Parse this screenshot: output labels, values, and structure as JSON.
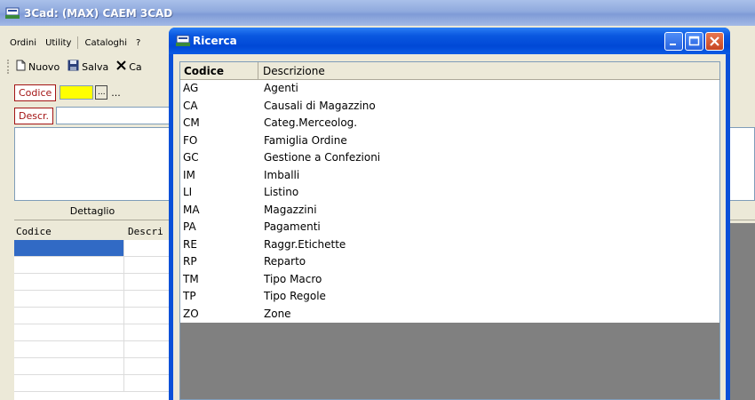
{
  "main_window": {
    "title": "3Cad: (MAX) CAEM 3CAD",
    "menu": [
      "Ordini",
      "Utility",
      "Cataloghi",
      "?"
    ],
    "toolbar": {
      "nuovo_label": "Nuovo",
      "salva_label": "Salva",
      "cancel_label": "Ca"
    },
    "codice_label": "Codice",
    "codice_browse": "...",
    "codice_dots": "...",
    "descr_label": "Descr.",
    "dettaglio_label": "Dettaglio",
    "grid": {
      "col_codice": "Codice",
      "col_descr": "Descri"
    }
  },
  "ricerca": {
    "title": "Ricerca",
    "columns": {
      "codice": "Codice",
      "descrizione": "Descrizione"
    },
    "rows": [
      {
        "codice": "AG",
        "descrizione": "Agenti"
      },
      {
        "codice": "CA",
        "descrizione": "Causali di Magazzino"
      },
      {
        "codice": "CM",
        "descrizione": "Categ.Merceolog."
      },
      {
        "codice": "FO",
        "descrizione": "Famiglia Ordine"
      },
      {
        "codice": "GC",
        "descrizione": "Gestione a Confezioni"
      },
      {
        "codice": "IM",
        "descrizione": "Imballi"
      },
      {
        "codice": "LI",
        "descrizione": "Listino"
      },
      {
        "codice": "MA",
        "descrizione": "Magazzini"
      },
      {
        "codice": "PA",
        "descrizione": "Pagamenti"
      },
      {
        "codice": "RE",
        "descrizione": "Raggr.Etichette"
      },
      {
        "codice": "RP",
        "descrizione": "Reparto"
      },
      {
        "codice": "TM",
        "descrizione": "Tipo Macro"
      },
      {
        "codice": "TP",
        "descrizione": "Tipo Regole"
      },
      {
        "codice": "ZO",
        "descrizione": "Zone"
      }
    ]
  },
  "colors": {
    "selection": "#316ac5",
    "codice_highlight": "#ffff00",
    "xp_blue": "#0a50d8"
  }
}
